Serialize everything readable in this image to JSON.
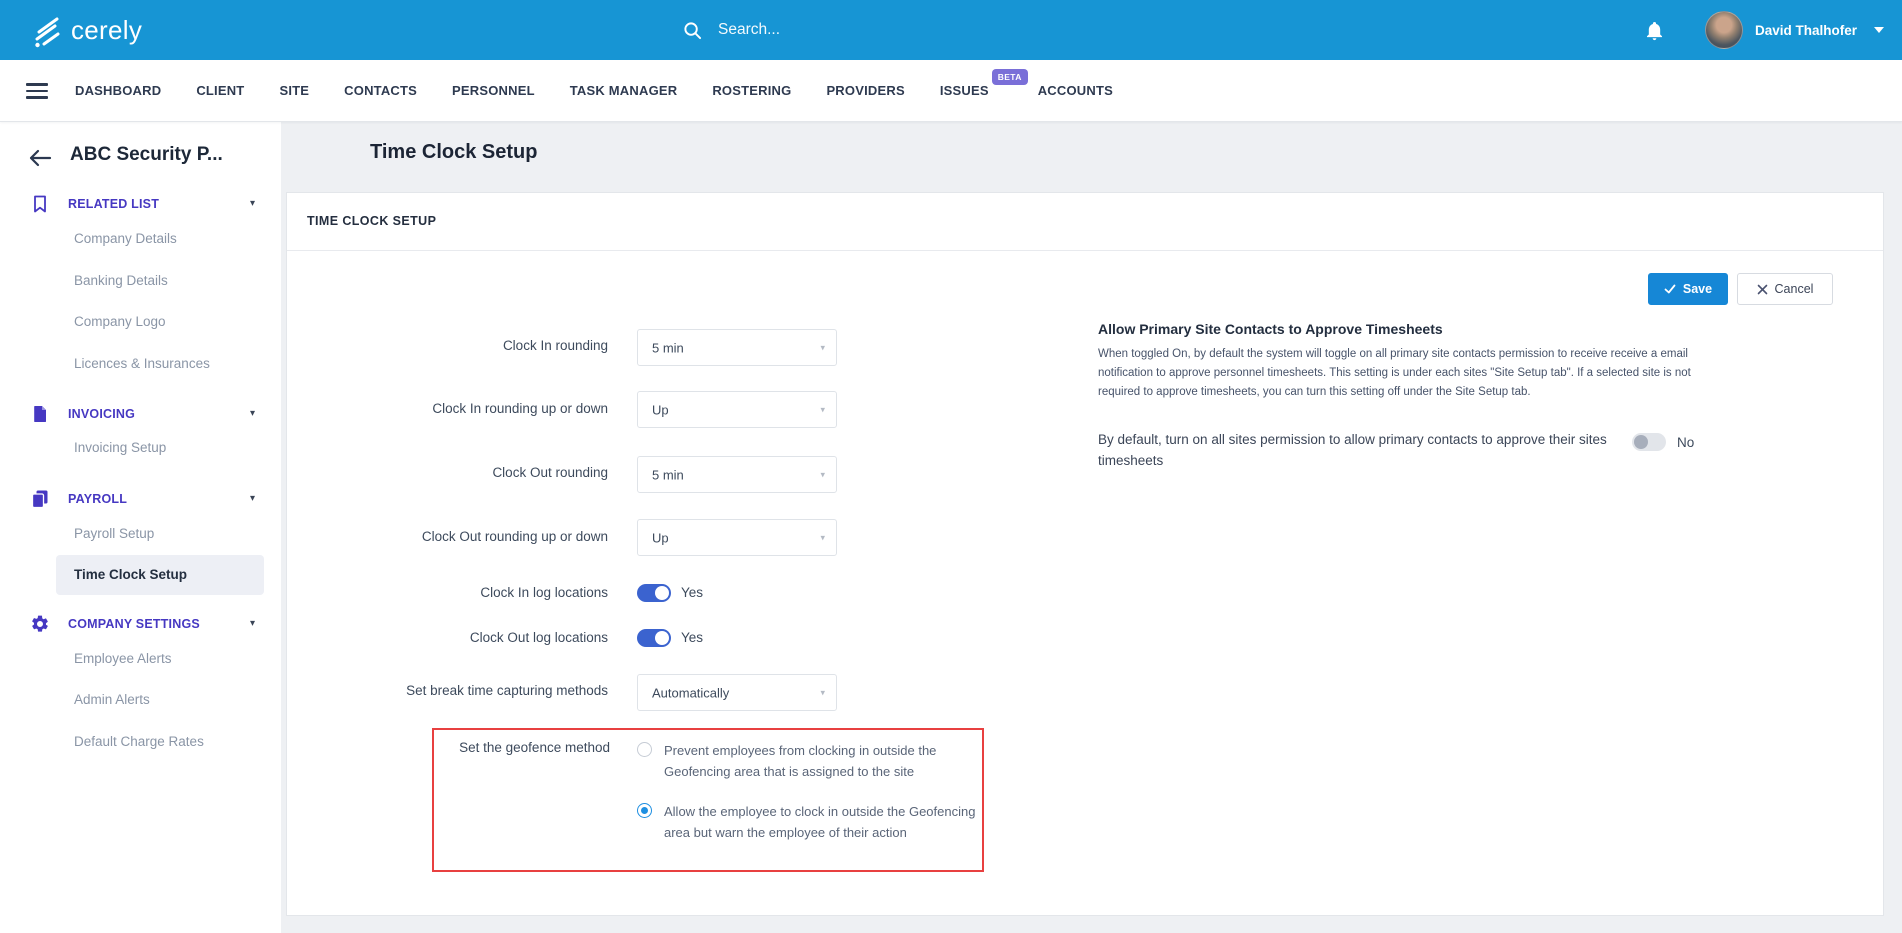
{
  "colors": {
    "header_blue": "#1795D4",
    "sidebar_indigo": "#4638C2",
    "toggle_on_blue": "#3B63CF",
    "radio_blue": "#1E8FE1",
    "save_blue": "#1687D6",
    "highlight_red": "#E84040",
    "beta_purple": "#7A6FD8"
  },
  "header": {
    "brand": "cerely",
    "search_placeholder": "Search...",
    "user_name": "David Thalhofer"
  },
  "nav": {
    "items": [
      "DASHBOARD",
      "CLIENT",
      "SITE",
      "CONTACTS",
      "PERSONNEL",
      "TASK MANAGER",
      "ROSTERING",
      "PROVIDERS",
      "ISSUES",
      "ACCOUNTS"
    ],
    "issues_badge": "BETA"
  },
  "sidebar": {
    "back_title": "ABC Security P...",
    "sections": [
      {
        "label": "RELATED LIST",
        "icon": "bookmark-icon",
        "items": [
          "Company Details",
          "Banking Details",
          "Company Logo",
          "Licences & Insurances"
        ]
      },
      {
        "label": "INVOICING",
        "icon": "document-icon",
        "items": [
          "Invoicing Setup"
        ]
      },
      {
        "label": "PAYROLL",
        "icon": "documents-icon",
        "items": [
          "Payroll Setup",
          "Time Clock Setup"
        ]
      },
      {
        "label": "COMPANY SETTINGS",
        "icon": "gear-icon",
        "items": [
          "Employee Alerts",
          "Admin Alerts",
          "Default Charge Rates"
        ]
      }
    ],
    "selected_item": "Time Clock Setup"
  },
  "main": {
    "page_title": "Time Clock Setup",
    "card_title": "TIME CLOCK SETUP",
    "save_label": "Save",
    "cancel_label": "Cancel",
    "form": {
      "clock_in_rounding": {
        "label": "Clock In rounding",
        "value": "5 min"
      },
      "clock_in_up_down": {
        "label": "Clock In rounding up or down",
        "value": "Up"
      },
      "clock_out_rounding": {
        "label": "Clock Out rounding",
        "value": "5 min"
      },
      "clock_out_up_down": {
        "label": "Clock Out rounding up or down",
        "value": "Up"
      },
      "clock_in_log": {
        "label": "Clock In log locations",
        "value": "Yes",
        "state": "on"
      },
      "clock_out_log": {
        "label": "Clock Out log locations",
        "value": "Yes",
        "state": "on"
      },
      "break_methods": {
        "label": "Set break time capturing methods",
        "value": "Automatically"
      },
      "geofence": {
        "label": "Set the geofence method",
        "options": [
          {
            "text": "Prevent employees from clocking in outside the Geofencing area that is assigned to the site",
            "selected": false
          },
          {
            "text": "Allow the employee to clock in outside the Geofencing area but warn the employee of their action",
            "selected": true
          }
        ]
      }
    },
    "approve_panel": {
      "heading": "Allow Primary Site Contacts to Approve Timesheets",
      "description": "When toggled On, by default the system will toggle on all primary site contacts permission to receive receive a email notification to approve personnel timesheets. This setting is under each sites \"Site Setup tab\". If a selected site is not required to approve timesheets, you can turn this setting off under the Site Setup tab.",
      "toggle_label": "By default, turn on all sites permission to allow primary contacts to approve their sites timesheets",
      "toggle_value": "No"
    }
  }
}
